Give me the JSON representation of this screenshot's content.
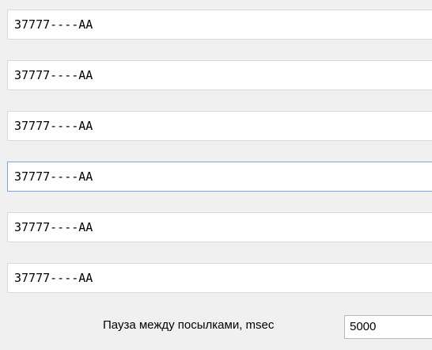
{
  "fields": [
    {
      "value": "37777----AA"
    },
    {
      "value": "37777----AA"
    },
    {
      "value": "37777----AA"
    },
    {
      "value": "37777----AA"
    },
    {
      "value": "37777----AA"
    },
    {
      "value": "37777----AA"
    }
  ],
  "pause": {
    "label": "Пауза между посылками, msec",
    "value": "5000"
  },
  "colors": {
    "background": "#f0f0f0",
    "field_border": "#d9d9d9",
    "focus_border": "#7aa7d9"
  }
}
